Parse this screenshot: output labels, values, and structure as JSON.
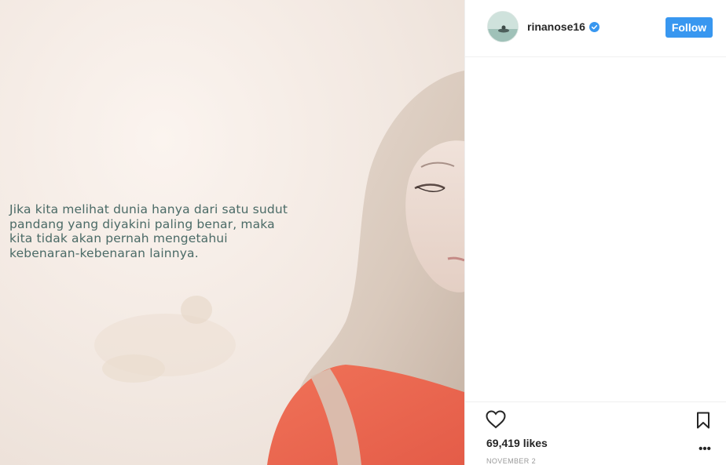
{
  "post": {
    "quote_lines": [
      "Jika kita melihat dunia hanya dari satu sudut",
      "pandang yang diyakini paling benar, maka",
      "kita tidak akan pernah mengetahui",
      "kebenaran-kebenaran lainnya."
    ]
  },
  "header": {
    "username": "rinanose16",
    "follow_label": "Follow",
    "verified_icon": "verified-badge-icon"
  },
  "footer": {
    "likes": "69,419 likes",
    "date": "NOVEMBER 2",
    "more_label": "•••"
  },
  "colors": {
    "follow_button": "#3897f0",
    "verified_badge": "#3897f0",
    "quote_text": "#4a6a66"
  }
}
